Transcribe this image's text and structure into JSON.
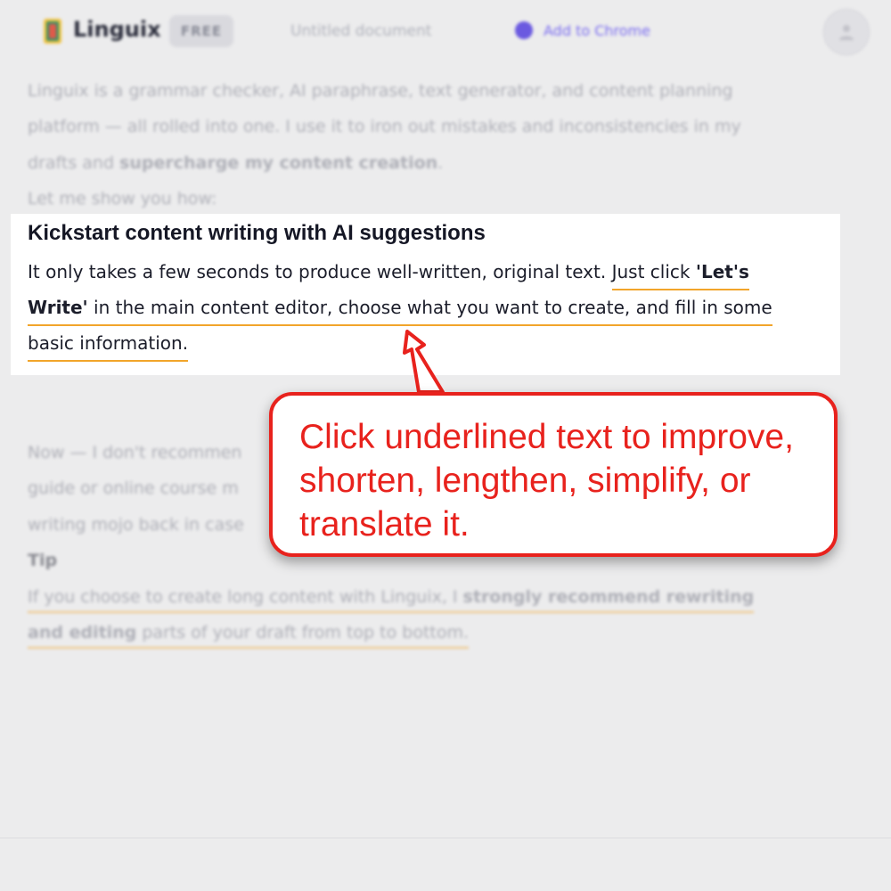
{
  "header": {
    "app_name": "Linguix",
    "plan_badge": "FREE",
    "document_title": "Untitled document",
    "add_to_chrome": "Add to Chrome",
    "icons": [
      "linguix-logo-icon",
      "chrome-icon",
      "user-avatar-icon"
    ]
  },
  "intro": {
    "line1": "Linguix is a grammar checker, AI paraphrase, text generator, and content planning",
    "line2": "platform — all rolled into one. I use it to iron out mistakes and inconsistencies in my",
    "line3_plain": "drafts and ",
    "line3_bold": "supercharge my content creation",
    "line3_end": ".",
    "line4": "Let me show you how:"
  },
  "highlight": {
    "heading": "Kickstart content writing with AI suggestions",
    "line1_plain": "It only takes a few seconds to produce well-written, original text. ",
    "line1_ul_plain": "Just click ",
    "line1_ul_bold": "'Let's",
    "line2_ul_bold": "Write'",
    "line2_ul_plain": " in the main content editor, choose what you want to create, and fill in some",
    "line3_ul_plain": "basic information."
  },
  "callout": {
    "text": "Click underlined text to improve, shorten, lengthen, simplify, or translate it."
  },
  "lower": {
    "line1": "Now — I don't recommen",
    "line2": "guide or online course m",
    "line3": "writing mojo back in case",
    "tip_label": "Tip",
    "tip1_plain": "If you choose to create long content with Linguix, I ",
    "tip1_bold": "strongly recommend rewriting",
    "tip2_bold": "and editing",
    "tip2_plain": " parts of your draft from top to bottom."
  },
  "colors": {
    "accent_red": "#e8221d",
    "underline_orange": "#f2a52b",
    "brand_purple": "#7a6cf0"
  }
}
